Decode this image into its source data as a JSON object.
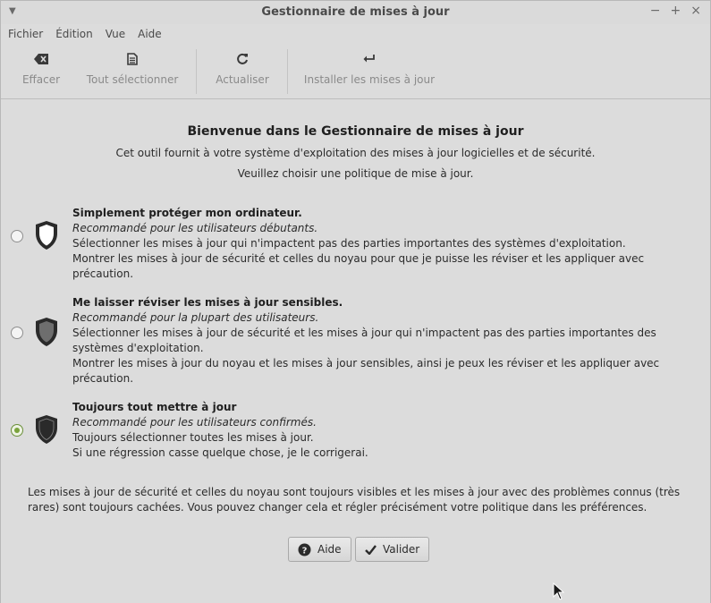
{
  "window": {
    "title": "Gestionnaire de mises à jour",
    "controls": {
      "minimize": "−",
      "maximize": "+",
      "close": "×"
    }
  },
  "menu": [
    "Fichier",
    "Édition",
    "Vue",
    "Aide"
  ],
  "toolbar": {
    "clear_label": "Effacer",
    "select_all_label": "Tout sélectionner",
    "refresh_label": "Actualiser",
    "install_label": "Installer les mises à jour"
  },
  "welcome": {
    "title": "Bienvenue dans le Gestionnaire de mises à jour",
    "description": "Cet outil fournit à votre système d'exploitation des mises à jour logicielles et de sécurité.",
    "prompt": "Veuillez choisir une politique de mise à jour."
  },
  "policies": [
    {
      "title": "Simplement protéger mon ordinateur.",
      "subtitle": "Recommandé pour les utilisateurs débutants.",
      "line1": "Sélectionner les mises à jour qui n'impactent pas des parties importantes des systèmes d'exploitation.",
      "line2": "Montrer les mises à jour de sécurité et celles du noyau pour que je puisse les réviser et les appliquer avec précaution.",
      "selected": false
    },
    {
      "title": "Me laisser réviser les mises à jour sensibles.",
      "subtitle": "Recommandé pour la plupart des utilisateurs.",
      "line1": "Sélectionner les mises à jour de sécurité et les mises à jour qui n'impactent pas des parties importantes des systèmes d'exploitation.",
      "line2": "Montrer les mises à jour du noyau et les mises à jour sensibles, ainsi je peux les réviser et les appliquer avec précaution.",
      "selected": false
    },
    {
      "title": "Toujours tout mettre à jour",
      "subtitle": "Recommandé pour les utilisateurs confirmés.",
      "line1": "Toujours sélectionner toutes les mises à jour.",
      "line2": "Si une régression casse quelque chose, je le corrigerai.",
      "selected": true
    }
  ],
  "note": "Les mises à jour de sécurité et celles du noyau sont toujours visibles et les mises à jour avec des problèmes connus (très rares) sont toujours cachées. Vous pouvez changer cela et régler précisément votre politique dans les préférences.",
  "buttons": {
    "help_label": "Aide",
    "validate_label": "Valider"
  },
  "colors": {
    "accent_green": "#7aa33c",
    "shield_dark": "#2a2a2a",
    "shield_mid": "#6e6e6e"
  }
}
